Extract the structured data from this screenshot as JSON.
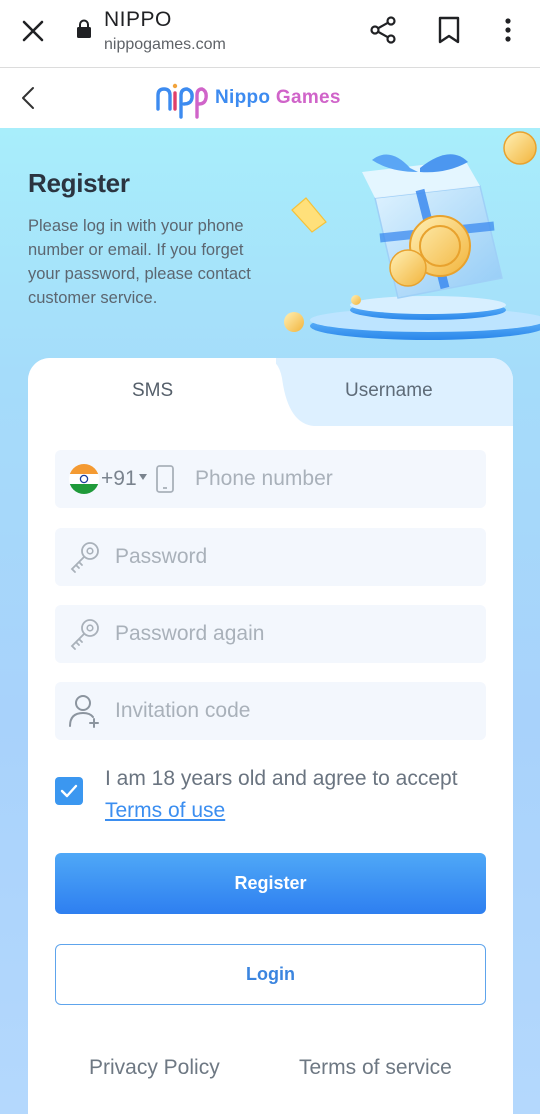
{
  "browser": {
    "title": "NIPPO",
    "url": "nippogames.com",
    "icons": [
      "close-icon",
      "lock-icon",
      "share-icon",
      "bookmark-icon",
      "more-icon"
    ]
  },
  "header": {
    "brand_part1": "Nippo",
    "brand_part2": "Games",
    "icons": [
      "back-icon",
      "nippo-logo"
    ]
  },
  "hero": {
    "title": "Register",
    "description": "Please log in with your phone number or email. If you forget your password, please contact customer service."
  },
  "tabs": [
    {
      "label": "SMS",
      "active": true
    },
    {
      "label": "Username",
      "active": false
    }
  ],
  "form": {
    "country_code": "+91",
    "phone_placeholder": "Phone number",
    "password_placeholder": "Password",
    "password_again_placeholder": "Password again",
    "invitation_placeholder": "Invitation code",
    "agree_text": "I am 18 years old and agree to accept",
    "terms_link": "Terms of use",
    "agree_checked": true
  },
  "buttons": {
    "register": "Register",
    "login": "Login"
  },
  "footer": {
    "privacy": "Privacy Policy",
    "terms": "Terms of service"
  },
  "colors": {
    "accent": "#3b8ef0",
    "brand_blue": "#3d8bf0",
    "brand_pink": "#d064c9"
  }
}
